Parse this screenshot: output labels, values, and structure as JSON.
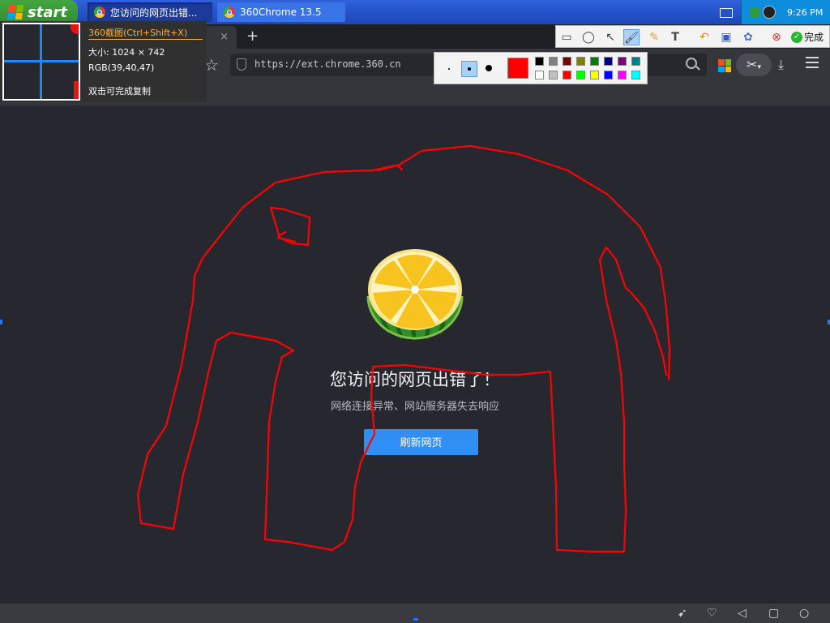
{
  "taskbar": {
    "start_label": "start",
    "tasks": [
      {
        "label": "您访问的网页出错...",
        "active": true
      },
      {
        "label": "360Chrome 13.5",
        "active": false
      }
    ],
    "clock": "9:26 PM"
  },
  "browser": {
    "url": "https://ext.chrome.360.cn",
    "new_tab_symbol": "+",
    "tab_close_symbol": "×"
  },
  "error_page": {
    "title": "您访问的网页出错了！",
    "subtitle": "网络连接异常、网站服务器失去响应",
    "refresh_button": "刷新网页"
  },
  "capture": {
    "title": "360截图(Ctrl+Shift+X)",
    "size_text": "大小: 1024 × 742",
    "rgb_text": "RGB(39,40,47)",
    "hint": "双击可完成复制",
    "done_label": "完成",
    "current_color": "#ff0000",
    "palette_colors": [
      "#000000",
      "#808080",
      "#800000",
      "#808000",
      "#008000",
      "#000080",
      "#800080",
      "#008080",
      "#ffffff",
      "#c0c0c0",
      "#ff0000",
      "#00ff00",
      "#ffff00",
      "#0000ff",
      "#ff00ff",
      "#00ffff"
    ],
    "tools": [
      "rectangle-icon",
      "ellipse-icon",
      "arrow-icon",
      "brush-icon",
      "highlighter-icon",
      "text-icon",
      "undo-icon",
      "save-icon",
      "mosaic-icon",
      "cancel-icon"
    ],
    "annotation_color": "#ff0000"
  },
  "icons": {
    "star": "star-icon",
    "scissors": "scissors-icon",
    "download": "download-icon",
    "menu": "menu-icon",
    "statusbar": [
      "rocket-icon",
      "heart-icon",
      "volume-icon",
      "window-icon",
      "search-icon"
    ]
  }
}
